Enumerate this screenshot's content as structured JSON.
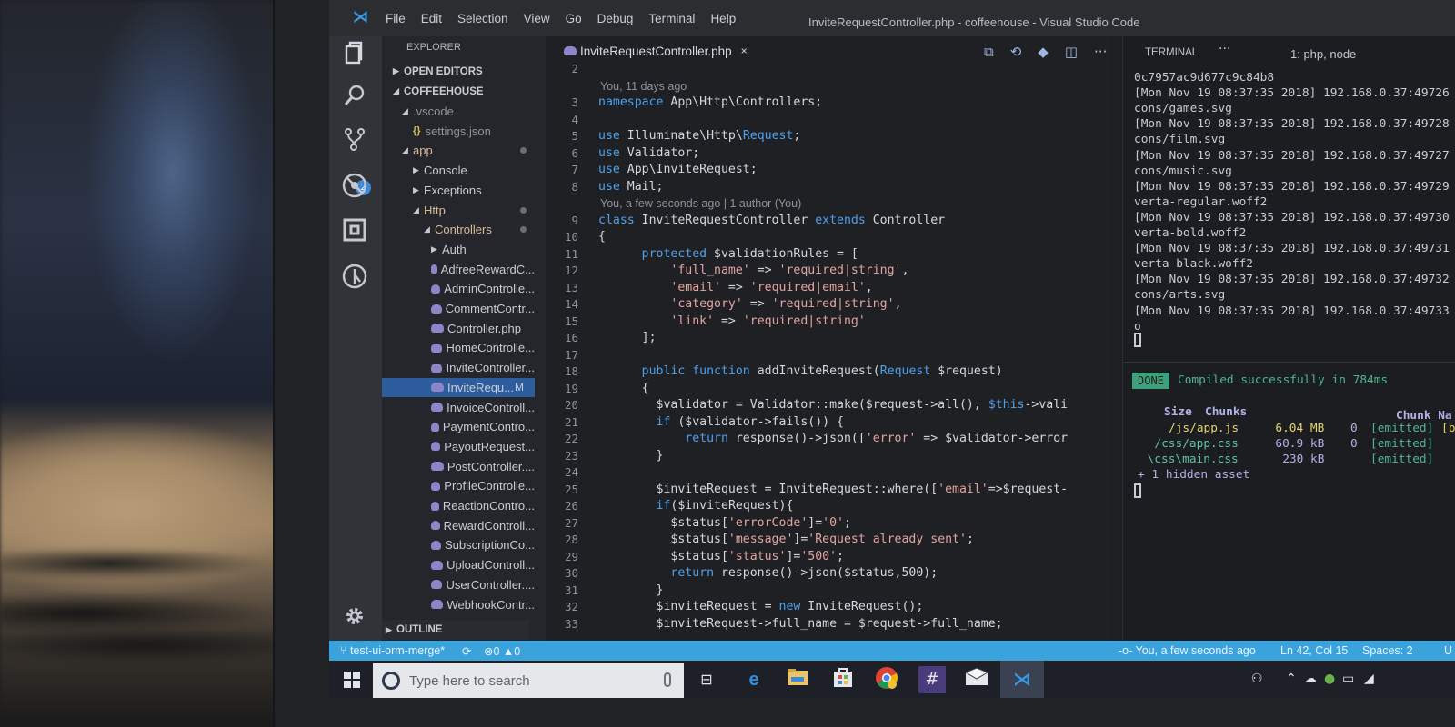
{
  "window": {
    "title": "InviteRequestController.php - coffeehouse - Visual Studio Code",
    "menu": [
      "File",
      "Edit",
      "Selection",
      "View",
      "Go",
      "Debug",
      "Terminal",
      "Help"
    ]
  },
  "activity_bar": {
    "items": [
      {
        "name": "explorer",
        "icon": "files-icon"
      },
      {
        "name": "search",
        "icon": "search-icon"
      },
      {
        "name": "source-control",
        "icon": "git-branch-icon",
        "badge": "2"
      },
      {
        "name": "debug",
        "icon": "no-bug-icon"
      },
      {
        "name": "extensions",
        "icon": "extensions-icon"
      },
      {
        "name": "gitlens",
        "icon": "git-history-icon"
      }
    ],
    "settings_icon": "gear-icon"
  },
  "sidebar": {
    "title": "EXPLORER",
    "open_editors": "OPEN EDITORS",
    "project": "COFFEEHOUSE",
    "tree": [
      {
        "label": ".vscode",
        "type": "folder-open",
        "depth": 1
      },
      {
        "label": "settings.json",
        "type": "json",
        "depth": 2
      },
      {
        "label": "app",
        "type": "folder-open",
        "depth": 1,
        "dot": true
      },
      {
        "label": "Console",
        "type": "folder",
        "depth": 2
      },
      {
        "label": "Exceptions",
        "type": "folder",
        "depth": 2
      },
      {
        "label": "Http",
        "type": "folder-open",
        "depth": 2,
        "dot": true
      },
      {
        "label": "Controllers",
        "type": "folder-open",
        "depth": 3,
        "dot": true
      },
      {
        "label": "Auth",
        "type": "folder",
        "depth": 4
      },
      {
        "label": "AdfreeRewardC...",
        "type": "php",
        "depth": 4
      },
      {
        "label": "AdminControlle...",
        "type": "php",
        "depth": 4
      },
      {
        "label": "CommentContr...",
        "type": "php",
        "depth": 4
      },
      {
        "label": "Controller.php",
        "type": "php",
        "depth": 4
      },
      {
        "label": "HomeControlle...",
        "type": "php",
        "depth": 4
      },
      {
        "label": "InviteController...",
        "type": "php",
        "depth": 4
      },
      {
        "label": "InviteRequ...",
        "type": "php",
        "depth": 4,
        "selected": true,
        "status": "M"
      },
      {
        "label": "InvoiceControll...",
        "type": "php",
        "depth": 4
      },
      {
        "label": "PaymentContro...",
        "type": "php",
        "depth": 4
      },
      {
        "label": "PayoutRequest...",
        "type": "php",
        "depth": 4
      },
      {
        "label": "PostController....",
        "type": "php",
        "depth": 4
      },
      {
        "label": "ProfileControlle...",
        "type": "php",
        "depth": 4
      },
      {
        "label": "ReactionContro...",
        "type": "php",
        "depth": 4
      },
      {
        "label": "RewardControll...",
        "type": "php",
        "depth": 4
      },
      {
        "label": "SubscriptionCo...",
        "type": "php",
        "depth": 4
      },
      {
        "label": "UploadControll...",
        "type": "php",
        "depth": 4
      },
      {
        "label": "UserController....",
        "type": "php",
        "depth": 4
      },
      {
        "label": "WebhookContr...",
        "type": "php",
        "depth": 4
      }
    ],
    "outline": "OUTLINE"
  },
  "editor": {
    "tab": {
      "label": "InviteRequestController.php",
      "close": "×"
    },
    "actions": [
      "open-changes-icon",
      "gitlens-compare-icon",
      "git-commit-icon",
      "split-editor-icon",
      "more-icon"
    ],
    "lens_1": "You, 11 days ago",
    "lens_2": "You, a few seconds ago | 1 author (You)",
    "lines": [
      {
        "n": "2",
        "code": ""
      },
      {
        "n": "3",
        "code": "namespace App\\Http\\Controllers;"
      },
      {
        "n": "4",
        "code": ""
      },
      {
        "n": "5",
        "code": "use Illuminate\\Http\\Request;"
      },
      {
        "n": "6",
        "code": "use Validator;"
      },
      {
        "n": "7",
        "code": "use App\\InviteRequest;"
      },
      {
        "n": "8",
        "code": "use Mail;"
      },
      {
        "n": "9",
        "code": "class InviteRequestController extends Controller"
      },
      {
        "n": "10",
        "code": "{"
      },
      {
        "n": "11",
        "code": "      protected $validationRules = ["
      },
      {
        "n": "12",
        "code": "          'full_name' => 'required|string',"
      },
      {
        "n": "13",
        "code": "          'email' => 'required|email',"
      },
      {
        "n": "14",
        "code": "          'category' => 'required|string',"
      },
      {
        "n": "15",
        "code": "          'link' => 'required|string'"
      },
      {
        "n": "16",
        "code": "      ];"
      },
      {
        "n": "17",
        "code": ""
      },
      {
        "n": "18",
        "code": "      public function addInviteRequest(Request $request)"
      },
      {
        "n": "19",
        "code": "      {"
      },
      {
        "n": "20",
        "code": "        $validator = Validator::make($request->all(), $this->vali"
      },
      {
        "n": "21",
        "code": "        if ($validator->fails()) {"
      },
      {
        "n": "22",
        "code": "            return response()->json(['error' => $validator->error"
      },
      {
        "n": "23",
        "code": "        }"
      },
      {
        "n": "24",
        "code": ""
      },
      {
        "n": "25",
        "code": "        $inviteRequest = InviteRequest::where(['email'=>$request-"
      },
      {
        "n": "26",
        "code": "        if($inviteRequest){"
      },
      {
        "n": "27",
        "code": "          $status['errorCode']='0';"
      },
      {
        "n": "28",
        "code": "          $status['message']='Request already sent';"
      },
      {
        "n": "29",
        "code": "          $status['status']='500';"
      },
      {
        "n": "30",
        "code": "          return response()->json($status,500);"
      },
      {
        "n": "31",
        "code": "        }"
      },
      {
        "n": "32",
        "code": "        $inviteRequest = new InviteRequest();"
      },
      {
        "n": "33",
        "code": "        $inviteRequest->full_name = $request->full_name;"
      }
    ]
  },
  "terminal": {
    "title": "TERMINAL",
    "more": "···",
    "selected": "1: php, node",
    "log": [
      "0c7957ac9d677c9c84b8",
      "[Mon Nov 19 08:37:35 2018] 192.168.0.37:49726",
      "cons/games.svg",
      "[Mon Nov 19 08:37:35 2018] 192.168.0.37:49728",
      "cons/film.svg",
      "[Mon Nov 19 08:37:35 2018] 192.168.0.37:49727",
      "cons/music.svg",
      "[Mon Nov 19 08:37:35 2018] 192.168.0.37:49729",
      "verta-regular.woff2",
      "[Mon Nov 19 08:37:35 2018] 192.168.0.37:49730",
      "verta-bold.woff2",
      "[Mon Nov 19 08:37:35 2018] 192.168.0.37:49731",
      "verta-black.woff2",
      "[Mon Nov 19 08:37:35 2018] 192.168.0.37:49732",
      "cons/arts.svg",
      "[Mon Nov 19 08:37:35 2018] 192.168.0.37:49733",
      "o"
    ],
    "build": {
      "done": "DONE",
      "message": "Compiled successfully in 784ms",
      "headers": {
        "size": "Size",
        "chunks": "Chunks",
        "chunk_names": "Chunk Na"
      },
      "assets": [
        {
          "name": "/js/app.js",
          "size": "6.04 MB",
          "chunk": "0",
          "status": "[emitted]",
          "extra": "[b"
        },
        {
          "name": "/css/app.css",
          "size": "60.9 kB",
          "chunk": "0",
          "status": "[emitted]",
          "extra": ""
        },
        {
          "name": "\\css\\main.css",
          "size": "230 kB",
          "chunk": "",
          "status": "[emitted]",
          "extra": ""
        }
      ],
      "hidden": "+ 1 hidden asset"
    }
  },
  "statusbar": {
    "branch": "test-ui-orm-merge*",
    "errors": "0",
    "warnings": "0",
    "blame": "You, a few seconds ago",
    "position": "Ln 42, Col 15",
    "spaces": "Spaces: 2",
    "encoding": "U",
    "color": "#3aa3dc"
  },
  "taskbar": {
    "search_placeholder": "Type here to search",
    "apps": [
      "task-view-icon",
      "edge-icon",
      "file-explorer-icon",
      "store-icon",
      "chrome-icon",
      "slack-icon",
      "mail-icon",
      "vscode-icon"
    ]
  }
}
